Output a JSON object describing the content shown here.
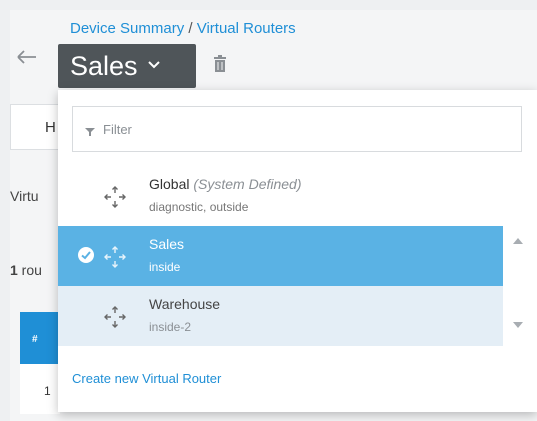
{
  "breadcrumb": {
    "parent": "Device Summary",
    "separator": " / ",
    "current": "Virtual Routers"
  },
  "header": {
    "title": "Sales",
    "back_icon": "arrow-left-icon",
    "trash_icon": "trash-icon"
  },
  "background": {
    "card_letter": "H",
    "virtual_text": "Virtu",
    "count_text_bold": "1",
    "count_text": " rou",
    "table_header": "#",
    "table_row_index": "1"
  },
  "dropdown": {
    "filter_placeholder": "Filter",
    "items": [
      {
        "name": "Global",
        "qualifier": "(System Defined)",
        "interfaces": "diagnostic, outside",
        "selected": false
      },
      {
        "name": "Sales",
        "qualifier": "",
        "interfaces": "inside",
        "selected": true
      },
      {
        "name": "Warehouse",
        "qualifier": "",
        "interfaces": "inside-2",
        "selected": false
      }
    ],
    "create_label": "Create new Virtual Router"
  },
  "colors": {
    "accent": "#1f8fd6",
    "selected_row": "#5ab2e4",
    "hover_row": "#e4eef6",
    "title_button": "#4f5559"
  }
}
